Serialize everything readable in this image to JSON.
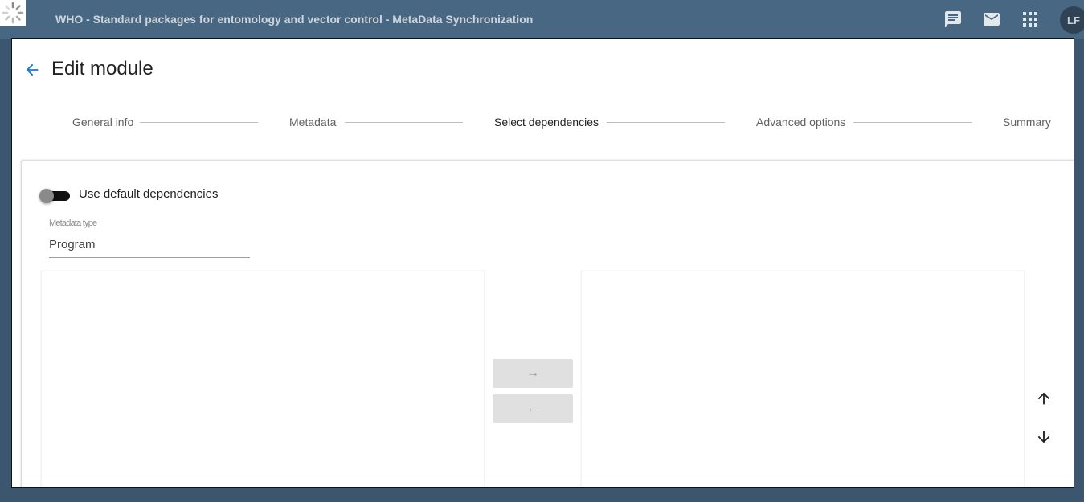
{
  "header": {
    "title": "WHO - Standard packages for entomology and vector control - MetaData Synchronization",
    "avatar_initials": "LF",
    "icons": [
      "spinner-logo-icon",
      "chat-icon",
      "mail-icon",
      "apps-grid-icon"
    ]
  },
  "page": {
    "title": "Edit module",
    "back_icon": "arrow-back-icon"
  },
  "stepper": {
    "steps": [
      {
        "label": "General info",
        "active": false
      },
      {
        "label": "Metadata",
        "active": false
      },
      {
        "label": "Select dependencies",
        "active": true
      },
      {
        "label": "Advanced options",
        "active": false
      },
      {
        "label": "Summary",
        "active": false
      }
    ]
  },
  "dependencies": {
    "toggle_label": "Use default dependencies",
    "toggle_on": false,
    "metadata_type": {
      "label": "Metadata type",
      "value": "Program"
    },
    "transfer": {
      "move_right": "→",
      "move_left": "←"
    },
    "order_icons": [
      "arrow-up-icon",
      "arrow-down-icon"
    ]
  },
  "colors": {
    "header_bg": "#486782",
    "accent": "#1976d2",
    "button_bg": "#e0e0e0"
  }
}
